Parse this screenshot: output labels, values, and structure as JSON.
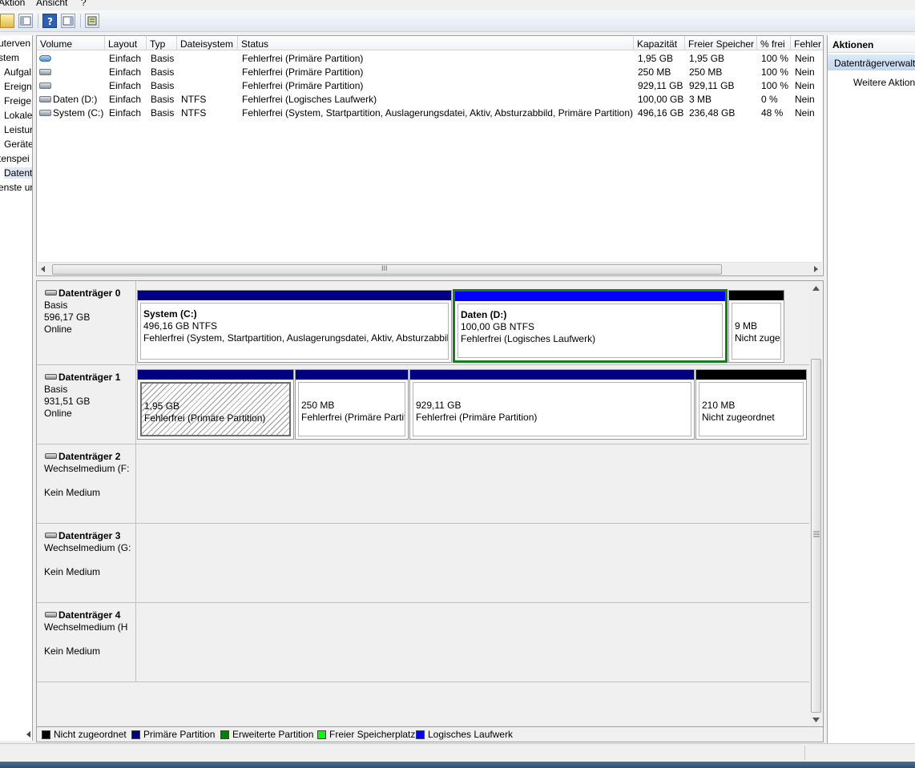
{
  "menu": [
    "Aktion",
    "Ansicht",
    "?"
  ],
  "tree": [
    "uterven",
    "stem",
    "Aufgal",
    "Ereign",
    "Freige",
    "Lokale",
    "Leistur",
    "Geräte",
    "tenspei",
    "Datent",
    "enste ur"
  ],
  "columns": [
    "Volume",
    "Layout",
    "Typ",
    "Dateisystem",
    "Status",
    "Kapazität",
    "Freier Speicher",
    "% frei",
    "Fehler"
  ],
  "volumes": [
    {
      "volume": "",
      "layout": "Einfach",
      "typ": "Basis",
      "fs": "",
      "status": "Fehlerfrei (Primäre Partition)",
      "cap": "1,95 GB",
      "free": "1,95 GB",
      "pct": "100 %",
      "fehler": "Nein"
    },
    {
      "volume": "",
      "layout": "Einfach",
      "typ": "Basis",
      "fs": "",
      "status": "Fehlerfrei (Primäre Partition)",
      "cap": "250 MB",
      "free": "250 MB",
      "pct": "100 %",
      "fehler": "Nein"
    },
    {
      "volume": "",
      "layout": "Einfach",
      "typ": "Basis",
      "fs": "",
      "status": "Fehlerfrei (Primäre Partition)",
      "cap": "929,11 GB",
      "free": "929,11 GB",
      "pct": "100 %",
      "fehler": "Nein"
    },
    {
      "volume": "Daten (D:)",
      "layout": "Einfach",
      "typ": "Basis",
      "fs": "NTFS",
      "status": "Fehlerfrei (Logisches Laufwerk)",
      "cap": "100,00 GB",
      "free": "3 MB",
      "pct": "0 %",
      "fehler": "Nein"
    },
    {
      "volume": "System (C:)",
      "layout": "Einfach",
      "typ": "Basis",
      "fs": "NTFS",
      "status": "Fehlerfrei (System, Startpartition, Auslagerungsdatei, Aktiv, Absturzabbild, Primäre Partition)",
      "cap": "496,16 GB",
      "free": "236,48 GB",
      "pct": "48 %",
      "fehler": "Nein"
    }
  ],
  "scroll_grip": "III",
  "disks": [
    {
      "name": "Datenträger 0",
      "type": "Basis",
      "size": "596,17 GB",
      "state": "Online",
      "parts": [
        {
          "title": "System  (C:)",
          "line1": "496,16 GB NTFS",
          "line2": "Fehlerfrei (System, Startpartition, Auslagerungsdatei, Aktiv, Absturzabbil"
        },
        {
          "title": "Daten  (D:)",
          "line1": "100,00 GB NTFS",
          "line2": "Fehlerfrei (Logisches Laufwerk)"
        },
        {
          "title": "",
          "line1": "9 MB",
          "line2": "Nicht zuge"
        }
      ]
    },
    {
      "name": "Datenträger 1",
      "type": "Basis",
      "size": "931,51 GB",
      "state": "Online",
      "parts": [
        {
          "line1": "1,95 GB",
          "line2": "Fehlerfrei (Primäre Partition)"
        },
        {
          "line1": "250 MB",
          "line2": "Fehlerfrei (Primäre Partit"
        },
        {
          "line1": "929,11 GB",
          "line2": "Fehlerfrei (Primäre Partition)"
        },
        {
          "line1": "210 MB",
          "line2": "Nicht zugeordnet"
        }
      ]
    },
    {
      "name": "Datenträger 2",
      "type": "Wechselmedium (F:",
      "state": "Kein Medium"
    },
    {
      "name": "Datenträger 3",
      "type": "Wechselmedium (G:",
      "state": "Kein Medium"
    },
    {
      "name": "Datenträger 4",
      "type": "Wechselmedium (H",
      "state": "Kein Medium"
    }
  ],
  "legend": [
    {
      "label": "Nicht zugeordnet",
      "color": "#000000"
    },
    {
      "label": "Primäre Partition",
      "color": "#000080"
    },
    {
      "label": "Erweiterte Partition",
      "color": "#008000"
    },
    {
      "label": "Freier Speicherplatz",
      "color": "#00ff00"
    },
    {
      "label": "Logisches Laufwerk",
      "color": "#0000ff"
    }
  ],
  "actions": {
    "header": "Aktionen",
    "section": "Datenträgerverwaltung",
    "more": "Weitere Aktionen"
  },
  "colors": {
    "primary": "#000080",
    "logical": "#0000ff",
    "unallocated": "#000000",
    "selection": "#1e7a1e"
  }
}
